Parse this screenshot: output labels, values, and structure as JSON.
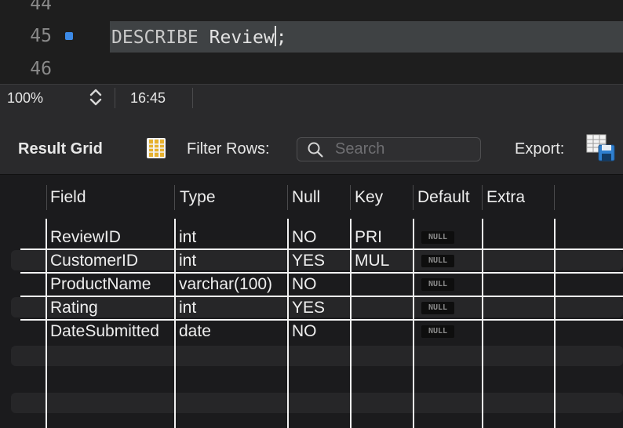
{
  "editor": {
    "lines": [
      {
        "number": "44",
        "code": ""
      },
      {
        "number": "45",
        "keyword": "DESCRIBE",
        "rest": " Review",
        "tail": ";"
      },
      {
        "number": "46",
        "code": ""
      }
    ]
  },
  "statusbar": {
    "zoom": "100%",
    "cursor_position": "16:45"
  },
  "toolbar": {
    "result_grid_label": "Result Grid",
    "filter_label": "Filter Rows:",
    "search_placeholder": "Search",
    "export_label": "Export:"
  },
  "grid": {
    "columns": [
      "Field",
      "Type",
      "Null",
      "Key",
      "Default",
      "Extra"
    ],
    "rows": [
      {
        "field": "ReviewID",
        "type": "int",
        "null": "NO",
        "key": "PRI",
        "default": "NULL",
        "extra": ""
      },
      {
        "field": "CustomerID",
        "type": "int",
        "null": "YES",
        "key": "MUL",
        "default": "NULL",
        "extra": ""
      },
      {
        "field": "ProductName",
        "type": "varchar(100)",
        "null": "NO",
        "key": "",
        "default": "NULL",
        "extra": ""
      },
      {
        "field": "Rating",
        "type": "int",
        "null": "YES",
        "key": "",
        "default": "NULL",
        "extra": ""
      },
      {
        "field": "DateSubmitted",
        "type": "date",
        "null": "NO",
        "key": "",
        "default": "NULL",
        "extra": ""
      }
    ]
  },
  "icons": {
    "breakpoint": "breakpoint-marker-icon",
    "grid": "result-grid-icon",
    "search": "search-icon",
    "export": "export-icon"
  },
  "colors": {
    "accent": "#3c8ae6",
    "highlight": "#3f4244"
  }
}
